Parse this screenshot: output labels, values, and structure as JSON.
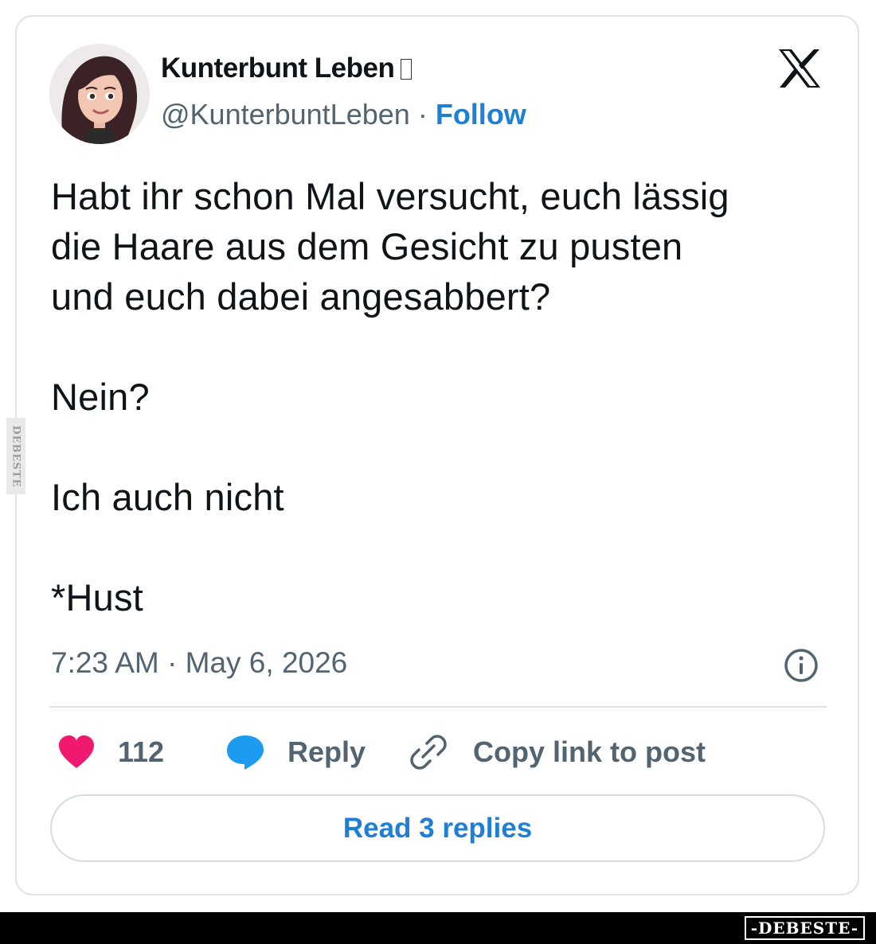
{
  "author": {
    "display_name": "Kunterbunt Leben",
    "handle": "@KunterbuntLeben",
    "separator": "·",
    "follow_label": "Follow"
  },
  "platform_logo": "x-logo-icon",
  "tweet": {
    "lines": [
      "Habt ihr schon Mal versucht, euch lässig",
      "die Haare aus dem Gesicht zu pusten",
      "und euch dabei angesabbert?",
      "Nein?",
      "Ich auch nicht",
      "*Hust"
    ]
  },
  "timestamp": "7:23 AM · May 6, 2026",
  "actions": {
    "like_count": "112",
    "reply_label": "Reply",
    "copy_label": "Copy link to post"
  },
  "read_replies_label": "Read 3 replies",
  "colors": {
    "accent": "#1d7fd6",
    "heart": "#f0186f",
    "reply_bubble": "#1d9bf0",
    "muted_text": "#536471"
  },
  "watermark": {
    "side": "DEBESTE",
    "bottom": "-DEBESTE-"
  }
}
